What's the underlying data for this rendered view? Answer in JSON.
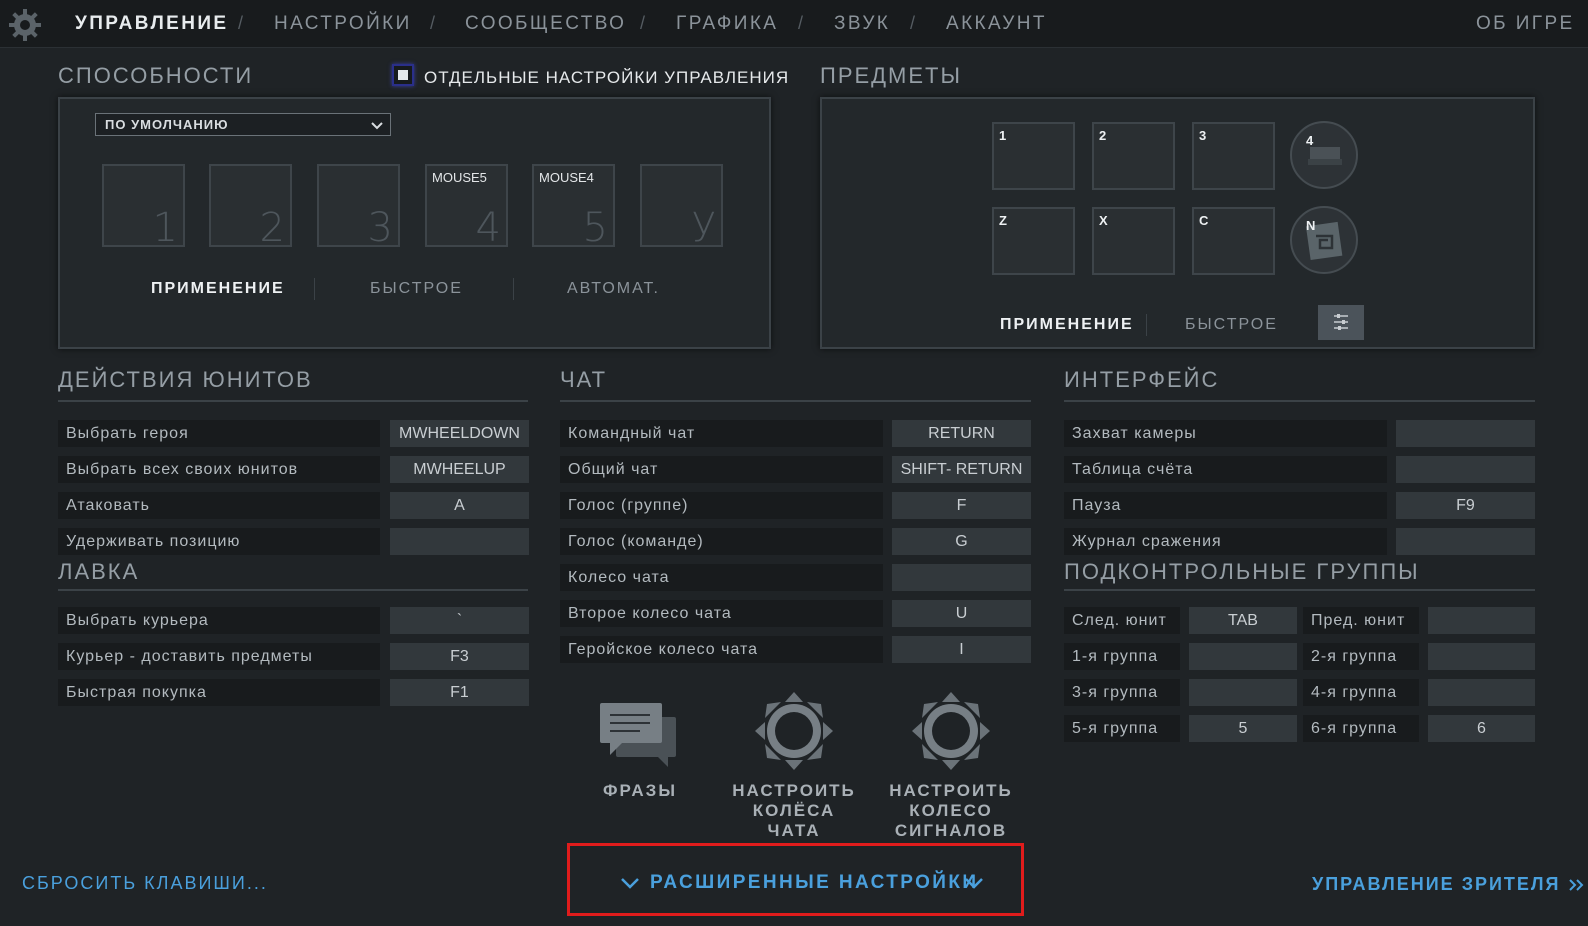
{
  "nav": {
    "items": [
      "УПРАВЛЕНИЕ",
      "НАСТРОЙКИ",
      "СООБЩЕСТВО",
      "ГРАФИКА",
      "ЗВУК",
      "АККАУНТ"
    ],
    "separator": "/",
    "about": "ОБ ИГРЕ"
  },
  "abilities": {
    "title": "СПОСОБНОСТИ",
    "separate_controls_label": "ОТДЕЛЬНЫЕ НАСТРОЙКИ УПРАВЛЕНИЯ",
    "separate_controls_checked": true,
    "preset": "ПО УМОЛЧАНИЮ",
    "slots": [
      {
        "key": "",
        "num": "1"
      },
      {
        "key": "",
        "num": "2"
      },
      {
        "key": "",
        "num": "3"
      },
      {
        "key": "MOUSE5",
        "num": "4"
      },
      {
        "key": "MOUSE4",
        "num": "5"
      },
      {
        "key": "",
        "num": "У"
      }
    ],
    "tabs": [
      "ПРИМЕНЕНИЕ",
      "БЫСТРОЕ",
      "АВТОМАТ."
    ]
  },
  "items": {
    "title": "ПРЕДМЕТЫ",
    "row1": [
      "1",
      "2",
      "3"
    ],
    "row2": [
      "Z",
      "X",
      "C"
    ],
    "round": [
      "4",
      "N"
    ],
    "tabs": [
      "ПРИМЕНЕНИЕ",
      "БЫСТРОЕ"
    ],
    "filter_icon": "sliders-icon"
  },
  "unit_actions": {
    "title": "ДЕЙСТВИЯ ЮНИТОВ",
    "rows": [
      {
        "label": "Выбрать героя",
        "key": "MWHEELDOWN"
      },
      {
        "label": "Выбрать всех своих юнитов",
        "key": "MWHEELUP"
      },
      {
        "label": "Атаковать",
        "key": "A"
      },
      {
        "label": "Удерживать позицию",
        "key": ""
      }
    ]
  },
  "shop": {
    "title": "ЛАВКА",
    "rows": [
      {
        "label": "Выбрать курьера",
        "key": "`"
      },
      {
        "label": "Курьер - доставить предметы",
        "key": "F3"
      },
      {
        "label": "Быстрая покупка",
        "key": "F1"
      }
    ]
  },
  "chat": {
    "title": "ЧАТ",
    "rows": [
      {
        "label": "Командный чат",
        "key": "RETURN"
      },
      {
        "label": "Общий чат",
        "key": "SHIFT- RETURN"
      },
      {
        "label": "Голос (группе)",
        "key": "F"
      },
      {
        "label": "Голос (команде)",
        "key": "G"
      },
      {
        "label": "Колесо чата",
        "key": ""
      },
      {
        "label": "Второе колесо чата",
        "key": "U"
      },
      {
        "label": "Геройское колесо чата",
        "key": "I"
      }
    ],
    "buttons": [
      {
        "label": "ФРАЗЫ",
        "icon": "chat-bubbles-icon"
      },
      {
        "label": "НАСТРОИТЬ КОЛЁСА ЧАТА",
        "icon": "chat-wheel-icon"
      },
      {
        "label": "НАСТРОИТЬ КОЛЕСО СИГНАЛОВ",
        "icon": "ping-wheel-icon"
      }
    ]
  },
  "interface": {
    "title": "ИНТЕРФЕЙС",
    "rows": [
      {
        "label": "Захват камеры",
        "key": ""
      },
      {
        "label": "Таблица счёта",
        "key": ""
      },
      {
        "label": "Пауза",
        "key": "F9"
      },
      {
        "label": "Журнал сражения",
        "key": ""
      }
    ]
  },
  "control_groups": {
    "title": "ПОДКОНТРОЛЬНЫЕ ГРУППЫ",
    "rows": [
      [
        {
          "label": "След. юнит",
          "key": "TAB"
        },
        {
          "label": "Пред. юнит",
          "key": ""
        }
      ],
      [
        {
          "label": "1-я группа",
          "key": ""
        },
        {
          "label": "2-я группа",
          "key": ""
        }
      ],
      [
        {
          "label": "3-я группа",
          "key": ""
        },
        {
          "label": "4-я группа",
          "key": ""
        }
      ],
      [
        {
          "label": "5-я группа",
          "key": "5"
        },
        {
          "label": "6-я группа",
          "key": "6"
        }
      ]
    ]
  },
  "footer": {
    "reset": "СБРОСИТЬ КЛАВИШИ...",
    "advanced": "РАСШИРЕННЫЕ НАСТРОЙКИ",
    "spectator": "УПРАВЛЕНИЕ ЗРИТЕЛЯ"
  },
  "colors": {
    "accent": "#4aa0dd",
    "highlight_box": "#e01c1c",
    "background": "#1f2326"
  }
}
